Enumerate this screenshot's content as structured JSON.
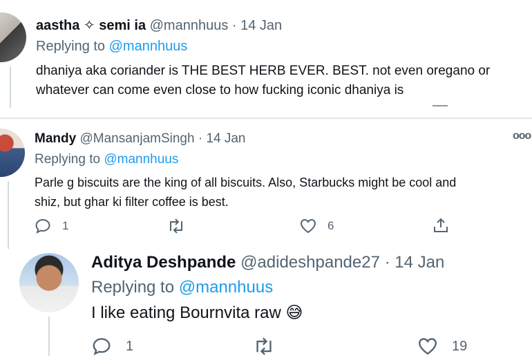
{
  "tweets": [
    {
      "name": "aastha ✧ semi ia",
      "handle": "@mannhuus",
      "sep": "·",
      "date": "14 Jan",
      "reply_prefix": "Replying to",
      "reply_to": "@mannhuus",
      "text_lines": [
        "dhaniya aka coriander is THE BEST HERB EVER. BEST. not even oregano or",
        "whatever can come even close to how fucking iconic dhaniya is"
      ]
    },
    {
      "name": "Mandy",
      "handle": "@MansanjamSingh",
      "sep": "·",
      "date": "14 Jan",
      "reply_prefix": "Replying to",
      "reply_to": "@mannhuus",
      "more_icon": "ooo",
      "text_lines": [
        "Parle g biscuits are the king of all biscuits. Also, Starbucks might be cool and",
        "shiz, but ghar ki filter coffee is best."
      ],
      "replies": "1",
      "likes": "6"
    },
    {
      "name": "Aditya Deshpande",
      "handle": "@adideshpande27",
      "sep": "·",
      "date": "14 Jan",
      "reply_prefix": "Replying to",
      "reply_to": "@mannhuus",
      "text": "I like eating Bournvita raw",
      "emoji": "😅",
      "replies": "1",
      "likes": "19"
    }
  ],
  "colors": {
    "link": "#1d9bf0",
    "muted": "#536471",
    "text": "#0f1419",
    "thread_line": "#cfd9de"
  }
}
